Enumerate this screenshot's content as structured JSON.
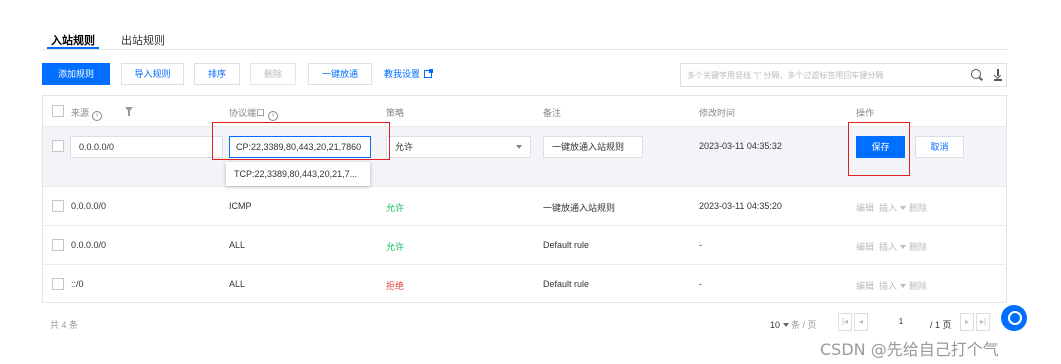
{
  "tabs": [
    {
      "label": "入站规则"
    },
    {
      "label": "出站规则"
    }
  ],
  "toolbar": {
    "add_label": "添加规则",
    "import_label": "导入规则",
    "sort_label": "排序",
    "delete_label": "删除",
    "allow_all_label": "一键放通",
    "tutorial_label": "教我设置"
  },
  "search": {
    "placeholder": "多个关键字用竖线 \"|\" 分隔，多个过滤标签用回车键分隔"
  },
  "table": {
    "headers": {
      "source": "来源",
      "protocol": "协议端口",
      "policy": "策略",
      "remark": "备注",
      "modified": "修改时间",
      "actions": "操作"
    },
    "edit_row": {
      "source_value": "0.0.0.0/0",
      "protocol_value": "CP:22,3389,80,443,20,21,7860",
      "policy_value": "允许",
      "remark_value": "一键放通入站规则",
      "modified": "2023-03-11 04:35:32",
      "save_label": "保存",
      "cancel_label": "取消"
    },
    "suggestion": "TCP:22,3389,80,443,20,21,7...",
    "rows": [
      {
        "source": "0.0.0.0/0",
        "protocol": "ICMP",
        "policy": "允许",
        "remark": "一键放通入站规则",
        "modified": "2023-03-11 04:35:20"
      },
      {
        "source": "0.0.0.0/0",
        "protocol": "ALL",
        "policy": "允许",
        "remark": "Default rule",
        "modified": "-"
      },
      {
        "source": "::/0",
        "protocol": "ALL",
        "policy": "拒绝",
        "remark": "Default rule",
        "modified": "-"
      }
    ],
    "row_actions": {
      "edit": "编辑",
      "insert": "插入",
      "delete": "删除"
    }
  },
  "footer": {
    "total": "共 4 条",
    "page_size": "10",
    "page_size_unit": "条 / 页",
    "current_page": "1",
    "page_total": "/ 1 页"
  },
  "watermark": "CSDN @先给自己打个气",
  "colors": {
    "primary": "#006eff",
    "allow": "#0abf5b",
    "deny": "#e54545",
    "highlight": "#e02020"
  }
}
